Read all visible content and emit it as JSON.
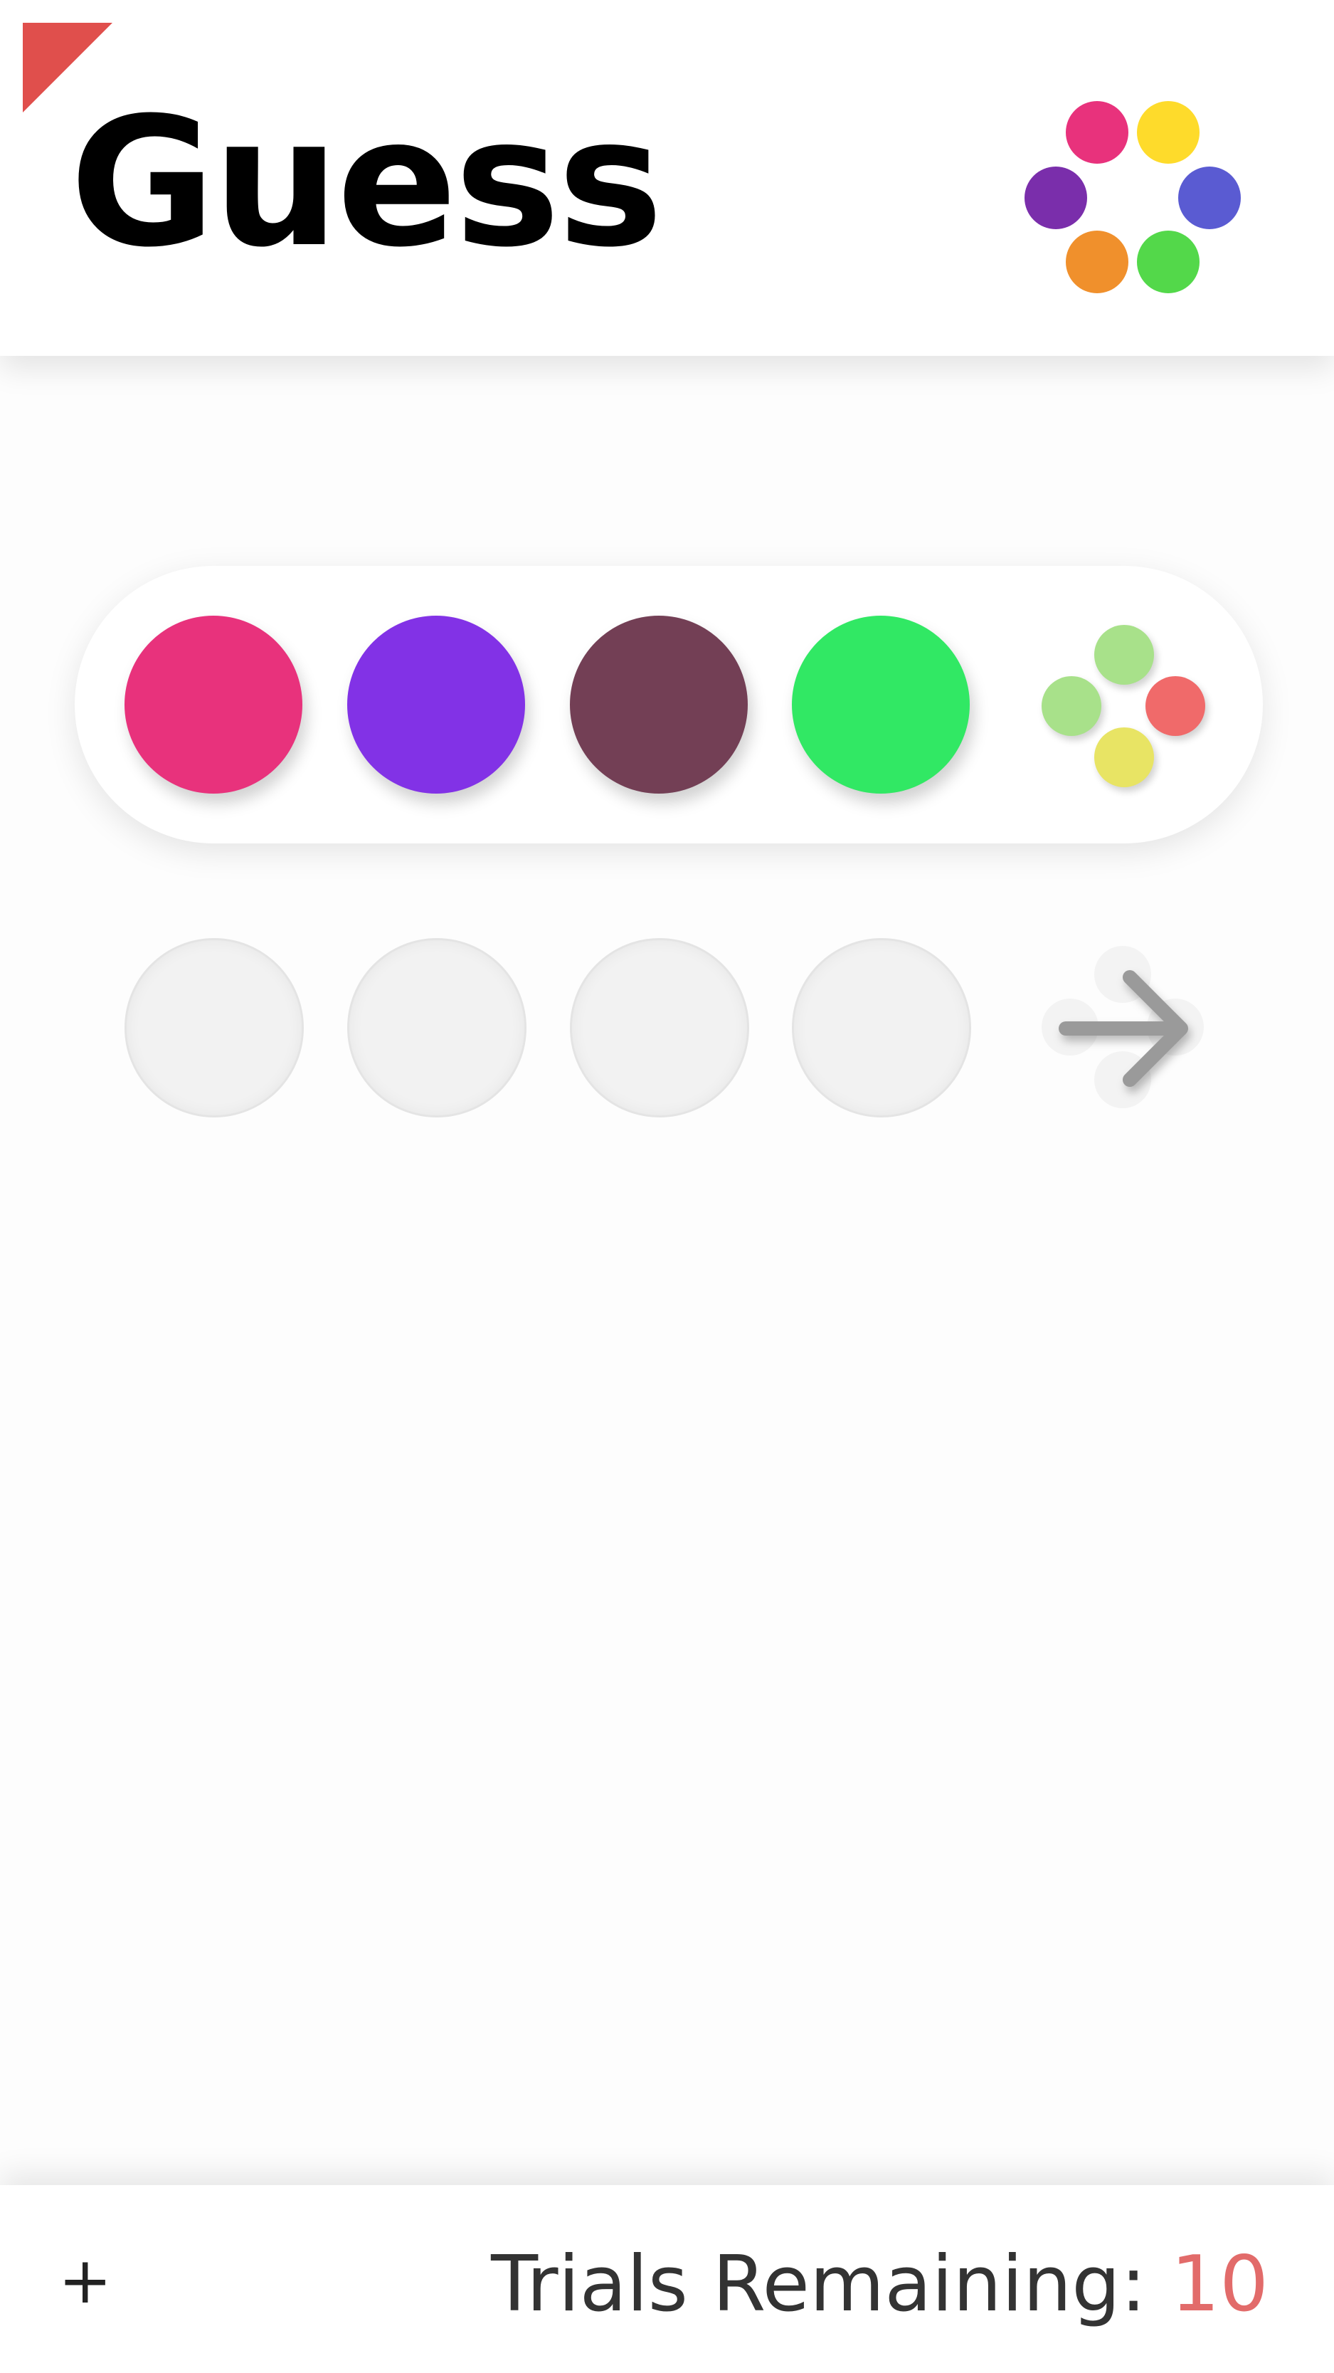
{
  "header": {
    "title": "Guess",
    "logo_colors": [
      "#e8327c",
      "#fedb2b",
      "#7a2eab",
      "#5a5bd2",
      "#f0902c",
      "#53d84a"
    ]
  },
  "guess": {
    "pegs": [
      {
        "color": "#e8327c"
      },
      {
        "color": "#8232e6"
      },
      {
        "color": "#733f55"
      },
      {
        "color": "#31e864"
      }
    ],
    "feedback_colors": [
      "#a8e18a",
      "#a8e18a",
      "#f06a6a",
      "#e8e464"
    ]
  },
  "next_row": {
    "slots": 4,
    "submit_icon": "arrow-right-icon"
  },
  "footer": {
    "add_label": "+",
    "trials_label": "Trials Remaining: ",
    "trials_count": "10"
  }
}
